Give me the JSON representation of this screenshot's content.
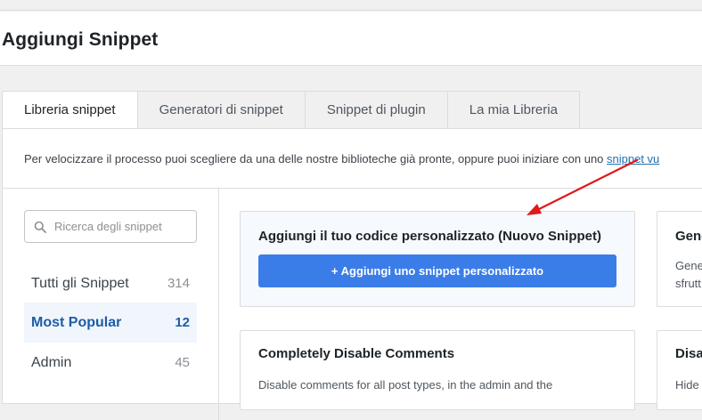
{
  "header": {
    "title": "Aggiungi Snippet"
  },
  "tabs": [
    {
      "label": "Libreria snippet",
      "active": true
    },
    {
      "label": "Generatori di snippet",
      "active": false
    },
    {
      "label": "Snippet di plugin",
      "active": false
    },
    {
      "label": "La mia Libreria",
      "active": false
    }
  ],
  "intro": {
    "text": "Per velocizzare il processo puoi scegliere da una delle nostre biblioteche già pronte, oppure puoi iniziare con uno ",
    "link": "snippet vu"
  },
  "search": {
    "placeholder": "Ricerca degli snippet",
    "value": ""
  },
  "categories": [
    {
      "label": "Tutti gli Snippet",
      "count": "314"
    },
    {
      "label": "Most Popular",
      "count": "12"
    },
    {
      "label": "Admin",
      "count": "45"
    }
  ],
  "cards": {
    "custom": {
      "title": "Aggiungi il tuo codice personalizzato (Nuovo Snippet)",
      "button": "+ Aggiungi uno snippet personalizzato"
    },
    "gene": {
      "title": "Gene",
      "desc1": "Gene",
      "desc2": "sfrutt"
    },
    "comments": {
      "title": "Completely Disable Comments",
      "desc": "Disable comments for all post types, in the admin and the"
    },
    "disa": {
      "title": "Disa",
      "desc": "Hide"
    }
  },
  "colors": {
    "accent": "#3b7de8",
    "active_category": "#1e5ba8",
    "annotation_arrow": "#e0191b"
  }
}
